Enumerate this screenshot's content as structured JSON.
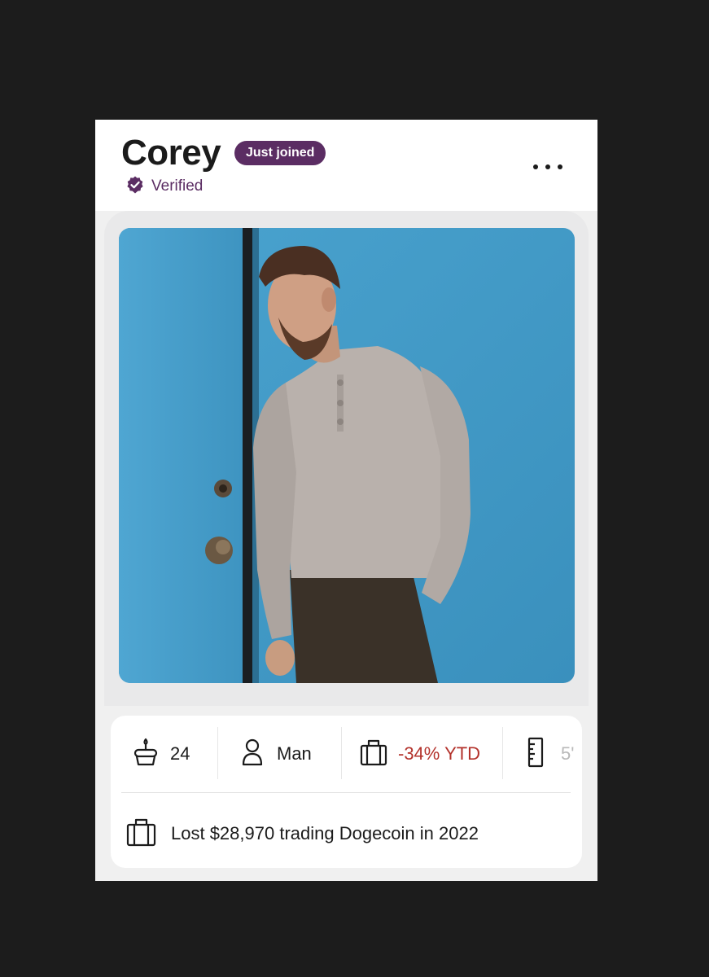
{
  "profile": {
    "name": "Corey",
    "badge": "Just joined",
    "verified_label": "Verified",
    "accent_color": "#5b2d63"
  },
  "photo": {
    "icon": "profile-photo",
    "subject": "man-leaning-on-blue-door"
  },
  "chips": [
    {
      "icon": "birthday-cake-icon",
      "label": "24"
    },
    {
      "icon": "person-icon",
      "label": "Man"
    },
    {
      "icon": "briefcase-icon",
      "label": "-34% YTD",
      "color": "#b3322b"
    },
    {
      "icon": "ruler-icon",
      "label": "5'"
    }
  ],
  "work_fact": {
    "icon": "briefcase-icon",
    "text": "Lost $28,970 trading Dogecoin in 2022"
  }
}
